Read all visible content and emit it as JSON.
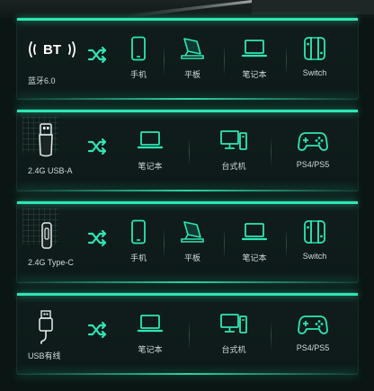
{
  "accent": "#2ee6b4",
  "rows": [
    {
      "source": {
        "icon": "bluetooth-icon",
        "label": "蓝牙6.0",
        "badge": "BT"
      },
      "devices": [
        {
          "icon": "phone-icon",
          "label": "手机"
        },
        {
          "icon": "tablet-icon",
          "label": "平板"
        },
        {
          "icon": "laptop-icon",
          "label": "笔记本"
        },
        {
          "icon": "switch-icon",
          "label": "Switch"
        }
      ]
    },
    {
      "source": {
        "icon": "usb-a-dongle-icon",
        "label": "2.4G USB-A"
      },
      "devices": [
        {
          "icon": "laptop-icon",
          "label": "笔记本"
        },
        {
          "icon": "desktop-icon",
          "label": "台式机"
        },
        {
          "icon": "gamepad-icon",
          "label": "PS4/PS5"
        }
      ]
    },
    {
      "source": {
        "icon": "usb-c-dongle-icon",
        "label": "2.4G Type-C"
      },
      "devices": [
        {
          "icon": "phone-icon",
          "label": "手机"
        },
        {
          "icon": "tablet-icon",
          "label": "平板"
        },
        {
          "icon": "laptop-icon",
          "label": "笔记本"
        },
        {
          "icon": "switch-icon",
          "label": "Switch"
        }
      ]
    },
    {
      "source": {
        "icon": "usb-cable-icon",
        "label": "USB有线"
      },
      "devices": [
        {
          "icon": "laptop-icon",
          "label": "笔记本"
        },
        {
          "icon": "desktop-icon",
          "label": "台式机"
        },
        {
          "icon": "gamepad-icon",
          "label": "PS4/PS5"
        }
      ]
    }
  ]
}
